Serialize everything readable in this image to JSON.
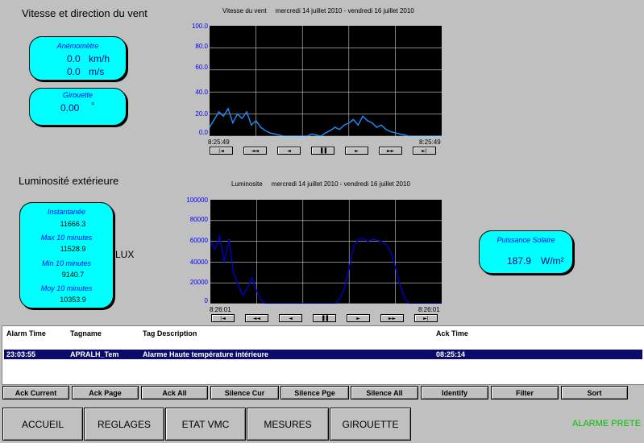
{
  "wind": {
    "title": "Vitesse et direction du vent",
    "chart_title": "Vitesse du vent     mercredi 14 juillet 2010 - vendredi 16 juillet 2010",
    "anemometer": {
      "caption": "Anémomètre",
      "kmh": "0.0",
      "kmh_unit": "km/h",
      "ms": "0.0",
      "ms_unit": "m/s"
    },
    "vane": {
      "caption": "Girouette",
      "value": "0.00",
      "unit": "°"
    },
    "time_start": "8:25:49",
    "time_end": "8:25:49"
  },
  "lum": {
    "title": "Luminosité extérieure",
    "chart_title": "Luminosite     mercredi 14 juillet 2010 - vendredi 16 juillet 2010",
    "inst_label": "Instantanée",
    "inst_value": "11666.3",
    "max_label": "Max 10 minutes",
    "max_value": "11528.9",
    "min_label": "Min 10 minutes",
    "min_value": "9140.7",
    "avg_label": "Moy 10 minutes",
    "avg_value": "10353.9",
    "unit": "LUX",
    "time_start": "8:26:01",
    "time_end": "8:26:01"
  },
  "solar": {
    "caption": "Puissance Solaire",
    "value": "187.9",
    "unit": "W/m²"
  },
  "playback": [
    "|◄",
    "◄◄",
    "◄",
    "▐▐",
    "►",
    "►►",
    "►|"
  ],
  "chart_data": [
    {
      "type": "line",
      "title": "Vitesse du vent     mercredi 14 juillet 2010 - vendredi 16 juillet 2010",
      "yticks": [
        "100.0",
        "80.0",
        "60.0",
        "40.0",
        "20.0",
        "0.0"
      ],
      "ylim": [
        0,
        100
      ],
      "xlim": [
        0,
        1
      ],
      "color": "#1e90ff",
      "series": [
        {
          "x": [
            0.0,
            0.02,
            0.04,
            0.06,
            0.08,
            0.1,
            0.12,
            0.14,
            0.16,
            0.18,
            0.2,
            0.22,
            0.24,
            0.26,
            0.28,
            0.3,
            0.32,
            0.34,
            0.36,
            0.38,
            0.4,
            0.42,
            0.44,
            0.46,
            0.48,
            0.5,
            0.52,
            0.54,
            0.56,
            0.58,
            0.6,
            0.62,
            0.64,
            0.66,
            0.68,
            0.7,
            0.72,
            0.74,
            0.76,
            0.78,
            0.8,
            0.82,
            0.84,
            0.86,
            0.88,
            0.9,
            0.92,
            0.94,
            0.96,
            0.98,
            1.0
          ],
          "y": [
            8,
            15,
            22,
            18,
            25,
            12,
            20,
            16,
            22,
            10,
            14,
            8,
            5,
            3,
            2,
            1,
            0,
            0,
            0,
            0,
            0,
            0,
            2,
            1,
            0,
            3,
            5,
            8,
            6,
            10,
            12,
            15,
            10,
            18,
            14,
            12,
            8,
            10,
            6,
            4,
            3,
            2,
            1,
            0,
            0,
            0,
            0,
            0,
            0,
            0,
            0
          ]
        }
      ]
    },
    {
      "type": "line",
      "title": "Luminosite     mercredi 14 juillet 2010 - vendredi 16 juillet 2010",
      "yticks": [
        "100000",
        "80000",
        "60000",
        "40000",
        "20000",
        "0"
      ],
      "ylim": [
        0,
        100000
      ],
      "xlim": [
        0,
        1
      ],
      "color": "#0000cd",
      "series": [
        {
          "x": [
            0.0,
            0.02,
            0.04,
            0.06,
            0.08,
            0.1,
            0.12,
            0.14,
            0.16,
            0.18,
            0.2,
            0.22,
            0.24,
            0.26,
            0.28,
            0.3,
            0.32,
            0.34,
            0.36,
            0.38,
            0.4,
            0.42,
            0.44,
            0.46,
            0.48,
            0.5,
            0.52,
            0.54,
            0.56,
            0.58,
            0.6,
            0.62,
            0.64,
            0.66,
            0.68,
            0.7,
            0.72,
            0.74,
            0.76,
            0.78,
            0.8,
            0.82,
            0.84,
            0.86,
            0.88,
            0.9,
            0.92,
            0.94,
            0.96,
            0.98,
            1.0
          ],
          "y": [
            60000,
            52000,
            65000,
            40000,
            62000,
            30000,
            18000,
            8000,
            15000,
            25000,
            12000,
            3000,
            0,
            0,
            0,
            0,
            0,
            0,
            0,
            0,
            0,
            0,
            0,
            0,
            0,
            0,
            0,
            0,
            5000,
            15000,
            35000,
            55000,
            62000,
            63000,
            60000,
            62000,
            61000,
            60000,
            57000,
            50000,
            35000,
            18000,
            5000,
            0,
            0,
            0,
            0,
            0,
            0,
            0,
            0
          ]
        }
      ]
    }
  ],
  "alarms": {
    "headers": {
      "time": "Alarm Time",
      "tag": "Tagname",
      "desc": "Tag Description",
      "ack": "Ack Time"
    },
    "row": {
      "time": "23:03:55",
      "tag": "APRALH_Tem",
      "desc": "Alarme Haute température intérieure",
      "ack": "08:25:14"
    }
  },
  "ack_buttons": [
    "Ack Current",
    "Ack Page",
    "Ack All",
    "Silence Cur",
    "Silence Pge",
    "Silence All",
    "Identify",
    "Filter",
    "Sort"
  ],
  "nav_buttons": [
    "ACCUEIL",
    "REGLAGES",
    "ETAT VMC",
    "MESURES",
    "GIROUETTE"
  ],
  "status": {
    "text": "ALARME PRETE",
    "color": "#00c000"
  }
}
